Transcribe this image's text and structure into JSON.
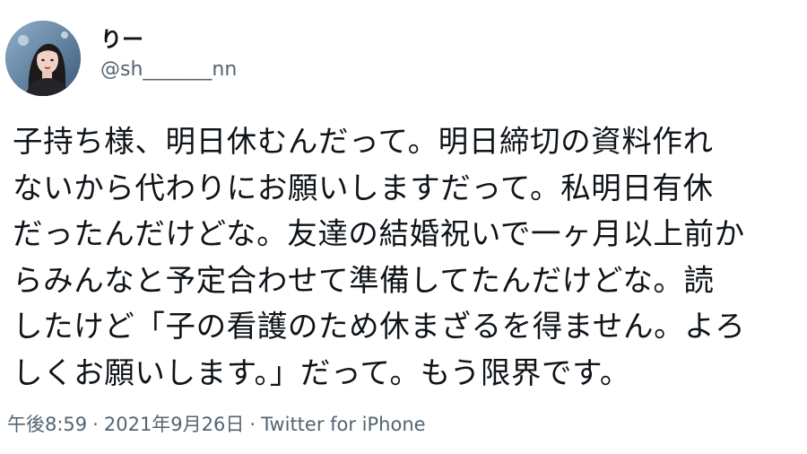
{
  "user": {
    "display_name": "りー",
    "handle": "@sh_______nn"
  },
  "tweet": {
    "lines": [
      "子持ち様、明日休むんだって。明日締切の資料作れ",
      "ないから代わりにお願いしますだって。私明日有休",
      "だったんだけどな。友達の結婚祝いで一ヶ月以上前か",
      "らみんなと予定合わせて準備してたんだけどな。読",
      "したけど「子の看護のため休まざるを得ません。よろ",
      "しくお願いします。」だって。もう限界です。"
    ]
  },
  "meta": {
    "time": "午後8:59",
    "separator": "·",
    "date": "2021年9月26日",
    "source": "Twitter for iPhone"
  }
}
